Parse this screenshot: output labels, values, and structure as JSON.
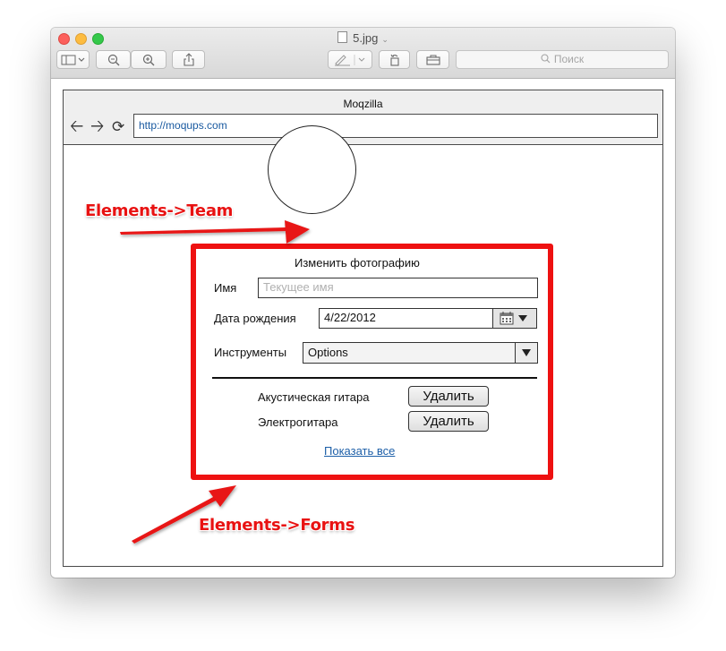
{
  "window": {
    "title": "5.jpg",
    "search_placeholder": "Поиск"
  },
  "mockup": {
    "browser_title": "Moqzilla",
    "url": "http://moqups.com",
    "form": {
      "change_photo": "Изменить фотографию",
      "name_label": "Имя",
      "name_placeholder": "Текущее имя",
      "birth_label": "Дата рождения",
      "birth_value": "4/22/2012",
      "instruments_label": "Инструменты",
      "instruments_value": "Options",
      "items": [
        {
          "name": "Акустическая гитара",
          "button": "Удалить"
        },
        {
          "name": "Электрогитара",
          "button": "Удалить"
        }
      ],
      "show_all": "Показать все"
    }
  },
  "annotations": {
    "team": "Elements->Team",
    "forms": "Elements->Forms",
    "color": "#e81212"
  }
}
